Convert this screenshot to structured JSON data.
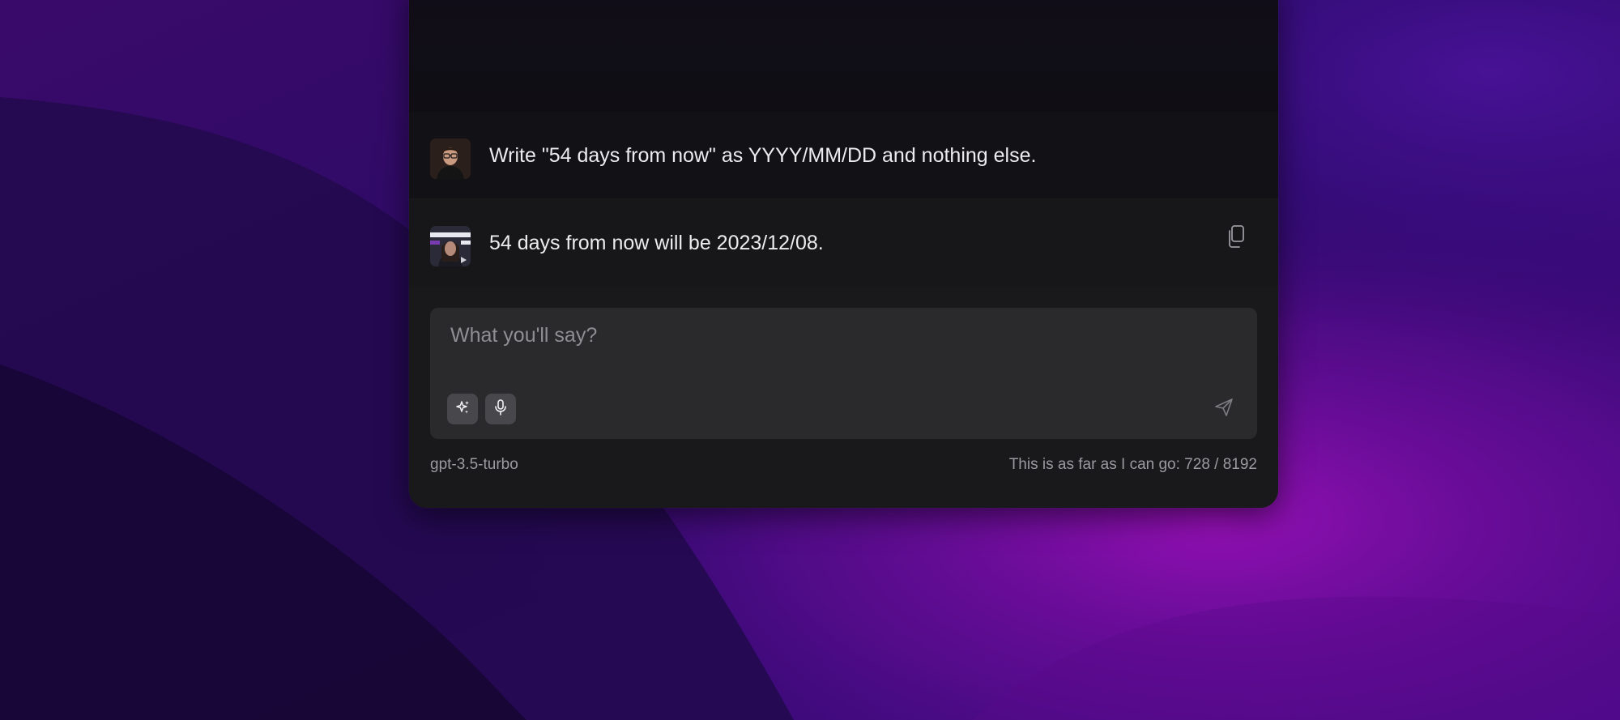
{
  "conversation": {
    "user_message": "Write \"54 days from now\" as YYYY/MM/DD and nothing else.",
    "assistant_message": "54 days from now will be 2023/12/08."
  },
  "composer": {
    "placeholder": "What you'll say?",
    "value": ""
  },
  "footer": {
    "model": "gpt-3.5-turbo",
    "limit_text": "This is as far as I can go: 728 / 8192"
  },
  "icons": {
    "copy": "copy-icon",
    "sparkle": "sparkle-icon",
    "microphone": "microphone-icon",
    "send": "send-icon"
  },
  "colors": {
    "window_bg": "#19191b",
    "input_bg": "#2a2a2c",
    "text_primary": "#ececee",
    "text_secondary": "#9a9a9f",
    "wallpaper_purple": "#8a0fb0"
  }
}
